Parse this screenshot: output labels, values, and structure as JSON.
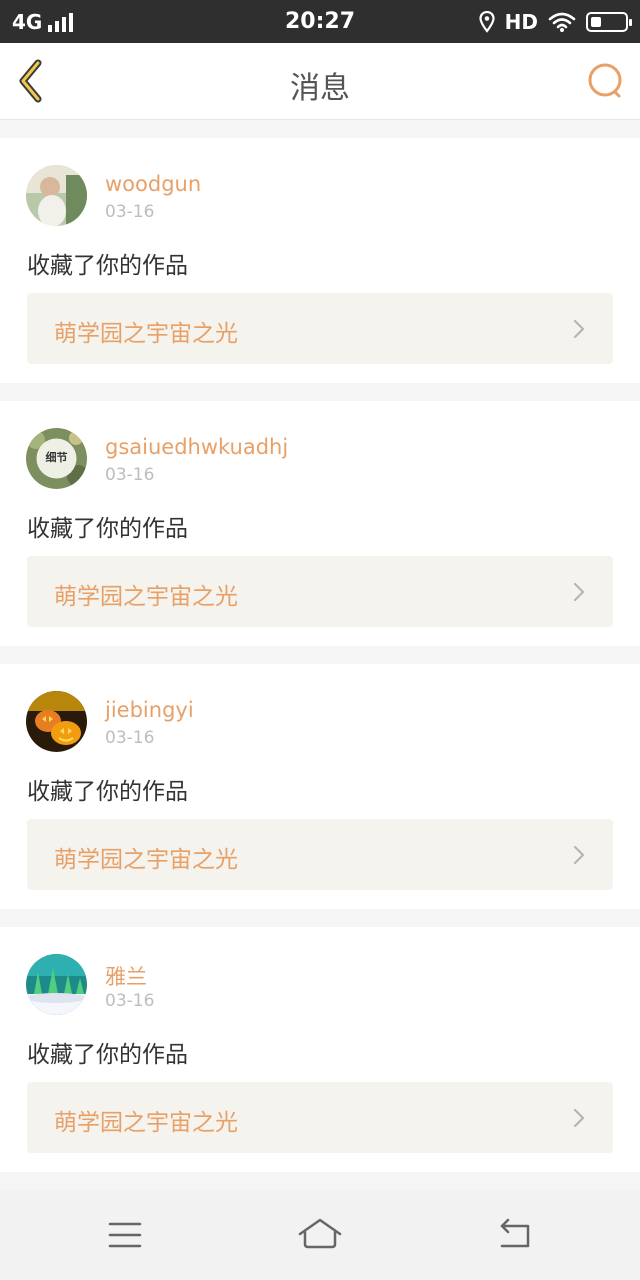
{
  "status_bar": {
    "network": "4G",
    "time": "20:27",
    "hd": "HD",
    "battery_level": 0.3
  },
  "header": {
    "title": "消息",
    "back_icon": "chevron-left-icon",
    "search_icon": "search-icon",
    "accent_color": "#e8a067"
  },
  "notifications": [
    {
      "username": "woodgun",
      "date": "03-16",
      "action": "收藏了你的作品",
      "work_title": "萌学园之宇宙之光"
    },
    {
      "username": "gsaiuedhwkuadhj",
      "date": "03-16",
      "action": "收藏了你的作品",
      "work_title": "萌学园之宇宙之光",
      "avatar_text": "细节"
    },
    {
      "username": "jiebingyi",
      "date": "03-16",
      "action": "收藏了你的作品",
      "work_title": "萌学园之宇宙之光"
    },
    {
      "username": "雅兰",
      "date": "03-16",
      "action": "收藏了你的作品",
      "work_title": "萌学园之宇宙之光"
    }
  ],
  "nav_bar": {
    "menu_icon": "menu-icon",
    "home_icon": "home-icon",
    "back_icon": "back-arrow-icon"
  }
}
